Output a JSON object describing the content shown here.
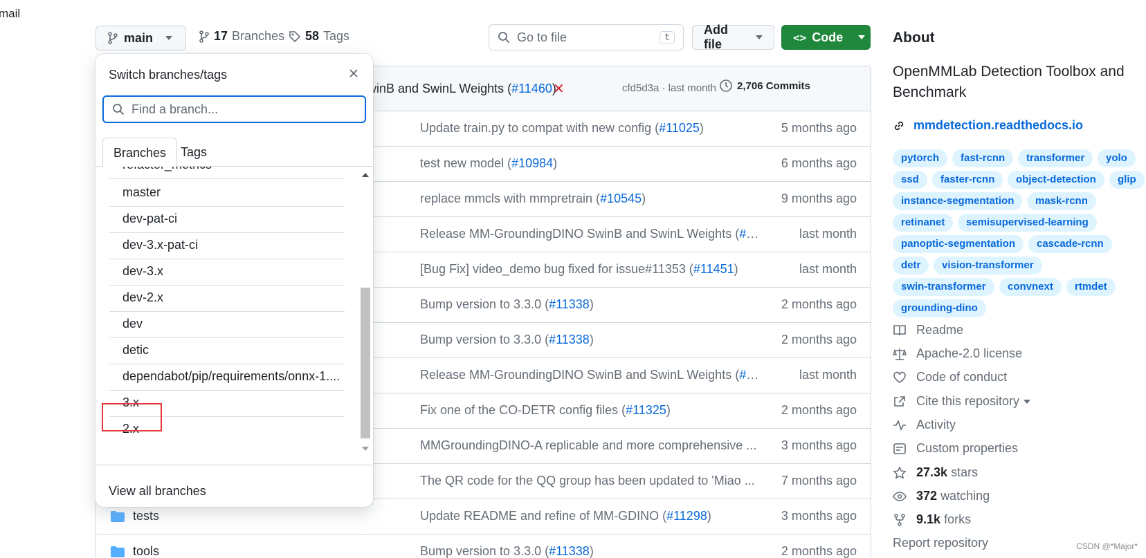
{
  "top": {
    "email_fragment": "mail"
  },
  "repo_bar": {
    "branch_label": "main",
    "branches_count": "17",
    "branches_label": "Branches",
    "tags_count": "58",
    "tags_label": "Tags",
    "go_to_file_placeholder": "Go to file",
    "go_to_file_key": "t",
    "add_file_label": "Add file",
    "code_label": "Code"
  },
  "latest_commit": {
    "message_fragment": "SwinB and SwinL Weights (",
    "pr": "#11460",
    "pr_close": ")",
    "status_icon": "x-icon",
    "hash_age": "cfd5d3a · last month",
    "commits_count": "2,706 Commits"
  },
  "file_rows": [
    {
      "name": "",
      "msg": "Update train.py to compat with new config (",
      "pr": "#11025",
      "tail": ")",
      "age": "5 months ago"
    },
    {
      "name": "",
      "msg": "test new model (",
      "pr": "#10984",
      "tail": ")",
      "age": "6 months ago"
    },
    {
      "name": "",
      "msg": "replace mmcls with mmpretrain (",
      "pr": "#10545",
      "tail": ")",
      "age": "9 months ago"
    },
    {
      "name": "",
      "msg": "Release MM-GroundingDINO SwinB and SwinL Weights (",
      "pr": "#11...",
      "tail": "",
      "age": "last month"
    },
    {
      "name": "",
      "msg": "[Bug Fix] video_demo bug fixed for issue#11353 (",
      "pr": "#11451",
      "tail": ")",
      "age": "last month"
    },
    {
      "name": "",
      "msg": "Bump version to 3.3.0 (",
      "pr": "#11338",
      "tail": ")",
      "age": "2 months ago"
    },
    {
      "name": "",
      "msg": "Bump version to 3.3.0 (",
      "pr": "#11338",
      "tail": ")",
      "age": "2 months ago"
    },
    {
      "name": "",
      "msg": "Release MM-GroundingDINO SwinB and SwinL Weights (",
      "pr": "#11...",
      "tail": "",
      "age": "last month"
    },
    {
      "name": "",
      "msg": "Fix one of the CO-DETR config files (",
      "pr": "#11325",
      "tail": ")",
      "age": "2 months ago"
    },
    {
      "name": "",
      "msg": "MMGroundingDINO-A replicable and more comprehensive ...",
      "pr": "",
      "tail": "",
      "age": "3 months ago"
    },
    {
      "name": "",
      "msg": "The QR code for the QQ group has been updated to 'Miao ...",
      "pr": "",
      "tail": "",
      "age": "7 months ago"
    },
    {
      "name": "tests",
      "msg": "Update README and refine of MM-GDINO (",
      "pr": "#11298",
      "tail": ")",
      "age": "3 months ago"
    },
    {
      "name": "tools",
      "msg": "Bump version to 3.3.0 (",
      "pr": "#11338",
      "tail": ")",
      "age": "2 months ago"
    }
  ],
  "dropdown": {
    "title": "Switch branches/tags",
    "search_placeholder": "Find a branch...",
    "tab_branches": "Branches",
    "tab_tags": "Tags",
    "partial_item": "refactor_metrics",
    "branches": [
      "master",
      "dev-pat-ci",
      "dev-3.x-pat-ci",
      "dev-3.x",
      "dev-2.x",
      "dev",
      "detic",
      "dependabot/pip/requirements/onnx-1....",
      "3.x",
      "2.x"
    ],
    "view_all": "View all branches"
  },
  "about": {
    "heading": "About",
    "description": "OpenMMLab Detection Toolbox and Benchmark",
    "website": "mmdetection.readthedocs.io",
    "topics": [
      "pytorch",
      "fast-rcnn",
      "transformer",
      "yolo",
      "ssd",
      "faster-rcnn",
      "object-detection",
      "glip",
      "instance-segmentation",
      "mask-rcnn",
      "retinanet",
      "semisupervised-learning",
      "panoptic-segmentation",
      "cascade-rcnn",
      "detr",
      "vision-transformer",
      "swin-transformer",
      "convnext",
      "rtmdet",
      "grounding-dino"
    ],
    "readme": "Readme",
    "license": "Apache-2.0 license",
    "conduct": "Code of conduct",
    "cite": "Cite this repository",
    "activity": "Activity",
    "custom_props": "Custom properties",
    "stars_count": "27.3k",
    "stars_label": "stars",
    "watching_count": "372",
    "watching_label": "watching",
    "forks_count": "9.1k",
    "forks_label": "forks",
    "report": "Report repository"
  },
  "watermark": "CSDN @*Major*",
  "colors": {
    "accent": "#0969da",
    "code_green": "#1f883d",
    "highlight_red": "#e5383b",
    "topic_bg": "#ddf4ff"
  }
}
